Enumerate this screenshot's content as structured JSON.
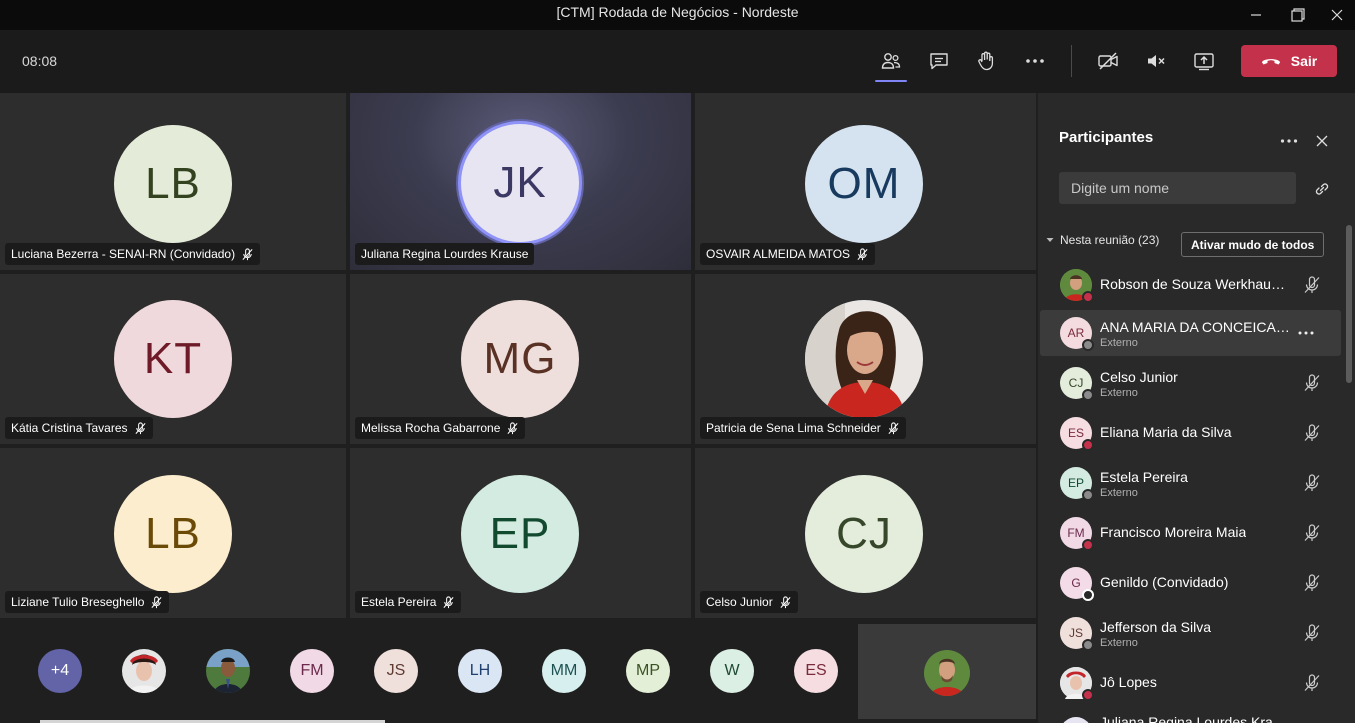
{
  "window": {
    "title": "[CTM] Rodada de Negócios - Nordeste"
  },
  "toolbar": {
    "timer": "08:08",
    "leave_label": "Sair",
    "icons": [
      "participants-icon",
      "chat-icon",
      "raise-hand-icon",
      "more-icon",
      "camera-off-icon",
      "mic-muted-icon",
      "share-tray-icon",
      "hang-up-icon"
    ]
  },
  "tiles": [
    {
      "initials": "LB",
      "name": "Luciana Bezerra - SENAI-RN (Convidado)",
      "bg": "#e4ecd9",
      "fg": "#33421f",
      "muted": true
    },
    {
      "initials": "JK",
      "name": "Juliana Regina Lourdes Krause",
      "bg": "#e8e5f2",
      "fg": "#3b3863",
      "muted": false,
      "speaking": true
    },
    {
      "initials": "OM",
      "name": "OSVAIR ALMEIDA MATOS",
      "bg": "#d5e3f1",
      "fg": "#173a5e",
      "muted": true
    },
    {
      "initials": "KT",
      "name": "Kátia Cristina Tavares",
      "bg": "#f0d9dc",
      "fg": "#6e1a28",
      "muted": true
    },
    {
      "initials": "MG",
      "name": "Melissa Rocha Gabarrone",
      "bg": "#efdfdc",
      "fg": "#5a3125",
      "muted": true
    },
    {
      "initials": "",
      "name": "Patricia de Sena Lima Schneider",
      "bg": "#c9a48e",
      "fg": "#000",
      "muted": true,
      "photo": true
    },
    {
      "initials": "LB",
      "name": "Liziane Tulio Breseghello",
      "bg": "#fbedcd",
      "fg": "#6b4a07",
      "muted": true
    },
    {
      "initials": "EP",
      "name": "Estela Pereira",
      "bg": "#d3ebe0",
      "fg": "#124a30",
      "muted": true
    },
    {
      "initials": "CJ",
      "name": "Celso Junior",
      "bg": "#e4ecdc",
      "fg": "#36472a",
      "muted": true
    }
  ],
  "strip": {
    "overflow_label": "+4",
    "avatars": [
      {
        "initials": "",
        "photo": "woman-red-hat",
        "bg": "#d8d8d8"
      },
      {
        "initials": "",
        "photo": "man-suit",
        "bg": "#6a8a5a"
      },
      {
        "initials": "FM",
        "bg": "#f1d9e6",
        "fg": "#6b2a4c"
      },
      {
        "initials": "JS",
        "bg": "#f0e0dc",
        "fg": "#5e3a33"
      },
      {
        "initials": "LH",
        "bg": "#dbe6f5",
        "fg": "#1f3f6e"
      },
      {
        "initials": "MM",
        "bg": "#d8efef",
        "fg": "#1e5252"
      },
      {
        "initials": "MP",
        "bg": "#e4efd8",
        "fg": "#3a5224"
      },
      {
        "initials": "W",
        "bg": "#dcefe4",
        "fg": "#1f4a32"
      },
      {
        "initials": "ES",
        "bg": "#f5dde2",
        "fg": "#7a2a3a"
      }
    ]
  },
  "panel": {
    "title": "Participantes",
    "search_placeholder": "Digite um nome",
    "section_label": "Nesta reunião (23)",
    "mute_all_label": "Ativar mudo de todos",
    "participants": [
      {
        "initials": "",
        "photo": true,
        "name": "Robson de Souza Werkhauser",
        "sub": "",
        "status": "busy",
        "bg": "#6a8f4a",
        "fg": "#fff"
      },
      {
        "initials": "AR",
        "name": "ANA MARIA DA CONCEICAO...",
        "sub": "Externo",
        "status": "offline",
        "bg": "#f3dbe0",
        "fg": "#7a2a3a",
        "hover": true
      },
      {
        "initials": "CJ",
        "name": "Celso Junior",
        "sub": "Externo",
        "status": "offline",
        "bg": "#e4ecdc",
        "fg": "#36472a"
      },
      {
        "initials": "ES",
        "name": "Eliana Maria da Silva",
        "sub": "",
        "status": "busy",
        "bg": "#f5dde2",
        "fg": "#7a2a3a"
      },
      {
        "initials": "EP",
        "name": "Estela Pereira",
        "sub": "Externo",
        "status": "offline",
        "bg": "#d3ebe0",
        "fg": "#124a30"
      },
      {
        "initials": "FM",
        "name": "Francisco Moreira Maia",
        "sub": "",
        "status": "busy",
        "bg": "#f1d9e6",
        "fg": "#6b2a4c"
      },
      {
        "initials": "G",
        "name": "Genildo (Convidado)",
        "sub": "",
        "status": "offline-white",
        "bg": "#f3dbe8",
        "fg": "#6b2a4c"
      },
      {
        "initials": "JS",
        "name": "Jefferson da Silva",
        "sub": "Externo",
        "status": "offline",
        "bg": "#f0e0dc",
        "fg": "#5e3a33"
      },
      {
        "initials": "",
        "photo": true,
        "name": "Jô Lopes",
        "sub": "",
        "status": "busy",
        "bg": "#d8d8d8",
        "fg": "#000"
      },
      {
        "initials": "",
        "name": "Juliana Regina Lourdes Krause",
        "sub": "",
        "status": "",
        "bg": "#e8e5f2",
        "fg": "#3b3863"
      }
    ]
  },
  "colors": {
    "leave": "#c4314b",
    "accent": "#7f85f5",
    "busy": "#c4314b"
  }
}
